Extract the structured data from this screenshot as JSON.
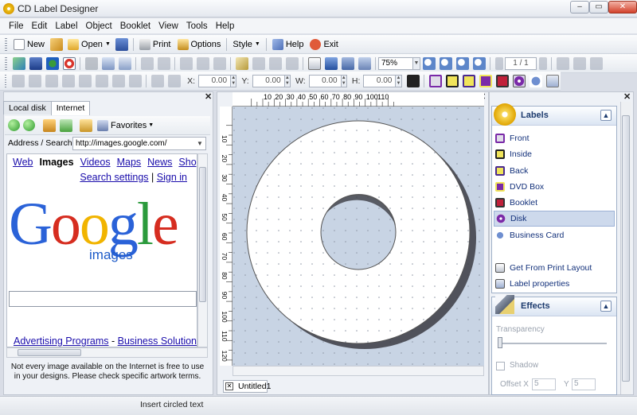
{
  "window": {
    "title": "CD Label Designer"
  },
  "menu": [
    "File",
    "Edit",
    "Label",
    "Object",
    "Booklet",
    "View",
    "Tools",
    "Help"
  ],
  "toolbar1": {
    "new": "New",
    "open": "Open",
    "print": "Print",
    "options": "Options",
    "style": "Style",
    "help": "Help",
    "exit": "Exit"
  },
  "toolbar2": {
    "zoom": "75%",
    "page": "1 / 1"
  },
  "toolbar3": {
    "x_label": "X:",
    "x_value": "0.00",
    "y_label": "Y:",
    "y_value": "0.00",
    "w_label": "W:",
    "w_value": "0.00",
    "h_label": "H:",
    "h_value": "0.00"
  },
  "left_panel": {
    "tabs": [
      "Local disk",
      "Internet"
    ],
    "favorites": "Favorites",
    "address_label": "Address / Search",
    "address_value": "http://images.google.com/",
    "nav_links": [
      "Web",
      "Images",
      "Videos",
      "Maps",
      "News",
      "Shopping"
    ],
    "search_settings": "Search settings",
    "link_sep": "|",
    "sign_in": "Sign in",
    "logo_letters": [
      "G",
      "o",
      "o",
      "g",
      "l",
      "e"
    ],
    "logo_sub": "images",
    "advertising": "Advertising Programs",
    "dash": "-",
    "business": "Business Solutions",
    "trailing_dash": "-",
    "disclaimer": "Not every image available on the Internet is free to use in your designs. Please check specific artwork terms."
  },
  "canvas": {
    "ruler_h": [
      "10",
      "20",
      "30",
      "40",
      "50",
      "60",
      "70",
      "80",
      "90",
      "100",
      "110"
    ],
    "ruler_v": [
      "10",
      "20",
      "30",
      "40",
      "50",
      "60",
      "70",
      "80",
      "90",
      "100",
      "110",
      "120"
    ],
    "doc_tab": "Untitled1"
  },
  "labels_panel": {
    "title": "Labels",
    "items": [
      "Front",
      "Inside",
      "Back",
      "DVD Box",
      "Booklet",
      "Disk",
      "Business Card"
    ],
    "selected": "Disk",
    "actions": [
      "Get From Print Layout",
      "Label properties"
    ]
  },
  "effects_panel": {
    "title": "Effects",
    "transparency": "Transparency",
    "shadow": "Shadow",
    "offset_x_label": "Offset X",
    "offset_x_value": "5",
    "offset_y_label": "Y",
    "offset_y_value": "5"
  },
  "status": {
    "text": "Insert circled text"
  },
  "colors": {
    "accent": "#1d3b6e",
    "selection": "#cdd9ec",
    "workspace": "#c8d4e4",
    "link": "#1a0dab"
  }
}
